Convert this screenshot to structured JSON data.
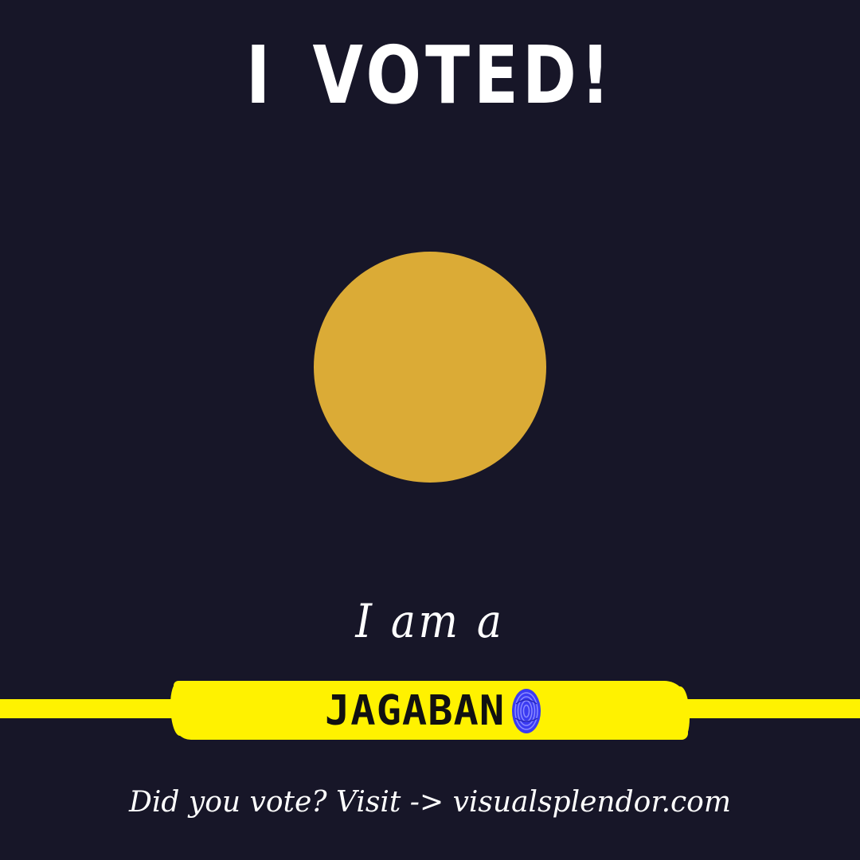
{
  "poster": {
    "headline": "I VOTED!",
    "tagline": "I am a",
    "banner_text": "JAGABAN",
    "footer": "Did you vote? Visit -> visualsplendor.com"
  },
  "colors": {
    "background": "#171628",
    "photo_placeholder": "#dbab36",
    "banner": "#fff200",
    "fingerprint_ink": "#3b3bf2"
  },
  "icons": {
    "fingerprint": "fingerprint-icon"
  }
}
